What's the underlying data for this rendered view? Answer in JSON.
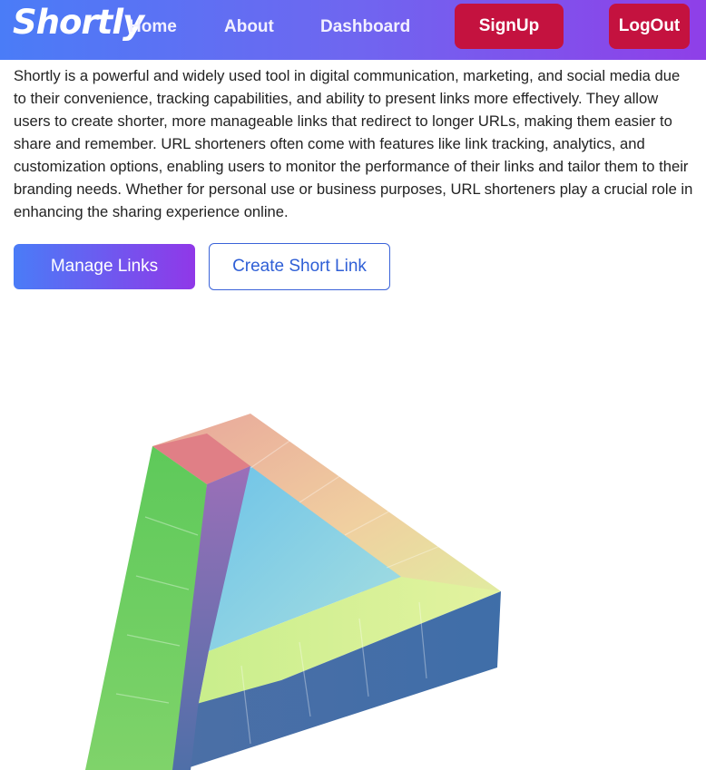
{
  "nav": {
    "logo": "Shortly",
    "links": [
      "Home",
      "About",
      "Dashboard"
    ],
    "signup_label": "SignUp",
    "logout_label": "LogOut"
  },
  "main": {
    "intro_text": "Shortly is a powerful and widely used tool in digital communication, marketing, and social media due to their convenience, tracking capabilities, and ability to present links more effectively. They allow users to create shorter, more manageable links that redirect to longer URLs, making them easier to share and remember. URL shorteners often come with features like link tracking, analytics, and customization options, enabling users to monitor the performance of their links and tailor them to their branding needs. Whether for personal use or business purposes, URL shorteners play a crucial role in enhancing the sharing experience online.",
    "manage_links_label": "Manage Links",
    "create_link_label": "Create Short Link"
  },
  "colors": {
    "nav_gradient_start": "#4a7cf7",
    "nav_gradient_end": "#8f3fe8",
    "auth_button": "#c4123f",
    "outline_blue": "#2f5fd6"
  }
}
